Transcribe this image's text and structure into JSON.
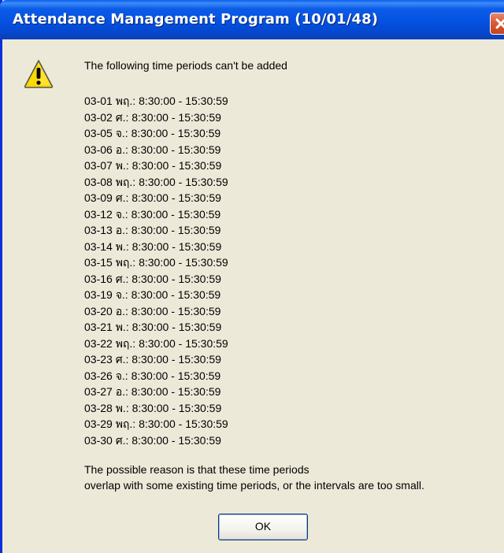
{
  "window": {
    "title": "Attendance Management Program (10/01/48)"
  },
  "icons": {
    "warning": "warning-icon",
    "close": "close-icon"
  },
  "message": "The following time periods can't be added",
  "periods": [
    "03-01 พฤ.:  8:30:00 - 15:30:59",
    "03-02 ศ.:  8:30:00 - 15:30:59",
    "03-05 จ.:  8:30:00 - 15:30:59",
    "03-06 อ.:  8:30:00 - 15:30:59",
    "03-07 พ.:  8:30:00 - 15:30:59",
    "03-08 พฤ.:  8:30:00 - 15:30:59",
    "03-09 ศ.:  8:30:00 - 15:30:59",
    "03-12 จ.:  8:30:00 - 15:30:59",
    "03-13 อ.:  8:30:00 - 15:30:59",
    "03-14 พ.:  8:30:00 - 15:30:59",
    "03-15 พฤ.:  8:30:00 - 15:30:59",
    "03-16 ศ.:  8:30:00 - 15:30:59",
    "03-19 จ.:  8:30:00 - 15:30:59",
    "03-20 อ.:  8:30:00 - 15:30:59",
    "03-21 พ.:  8:30:00 - 15:30:59",
    "03-22 พฤ.:  8:30:00 - 15:30:59",
    "03-23 ศ.:  8:30:00 - 15:30:59",
    "03-26 จ.:  8:30:00 - 15:30:59",
    "03-27 อ.:  8:30:00 - 15:30:59",
    "03-28 พ.:  8:30:00 - 15:30:59",
    "03-29 พฤ.:  8:30:00 - 15:30:59",
    "03-30 ศ.:  8:30:00 - 15:30:59"
  ],
  "reason": {
    "line1": "The possible reason is that these time periods",
    "line2": "overlap with some existing time periods, or the intervals are too small."
  },
  "buttons": {
    "ok_label": "OK"
  },
  "colors": {
    "titlebar": "#0553e2",
    "dialog_background": "#ece9d8",
    "close_button": "#d95c36",
    "warning_yellow": "#ffd800"
  }
}
